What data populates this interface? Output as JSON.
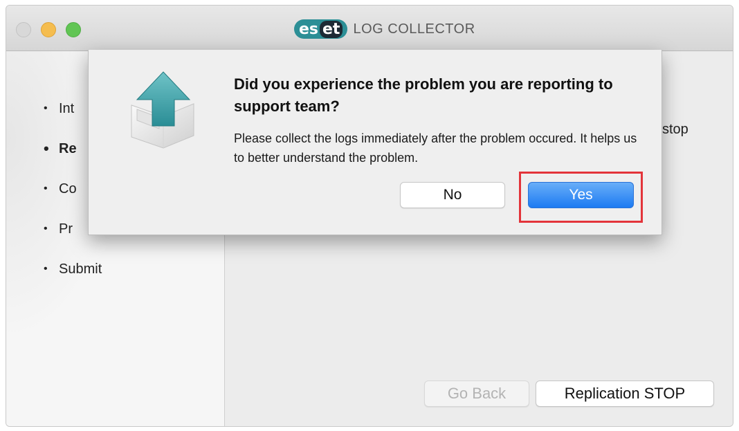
{
  "window": {
    "title": "LOG COLLECTOR",
    "logo_text": "eset"
  },
  "sidebar": {
    "items": [
      {
        "label": "Int",
        "current": false
      },
      {
        "label": "Re",
        "current": true
      },
      {
        "label": "Co",
        "current": false
      },
      {
        "label": "Pr",
        "current": false
      },
      {
        "label": "Submit",
        "current": false
      }
    ]
  },
  "content": {
    "partial_text": "stop"
  },
  "footer": {
    "go_back_label": "Go Back",
    "replication_stop_label": "Replication STOP"
  },
  "dialog": {
    "title": "Did you experience the problem you are reporting to support team?",
    "body": "Please collect the logs immediately after the problem occured. It helps us to better understand the problem.",
    "no_label": "No",
    "yes_label": "Yes",
    "icon": "upload-box-icon"
  },
  "colors": {
    "accent_blue": "#1d7bf2",
    "highlight_red": "#e3343a",
    "eset_teal": "#2c8f96"
  }
}
